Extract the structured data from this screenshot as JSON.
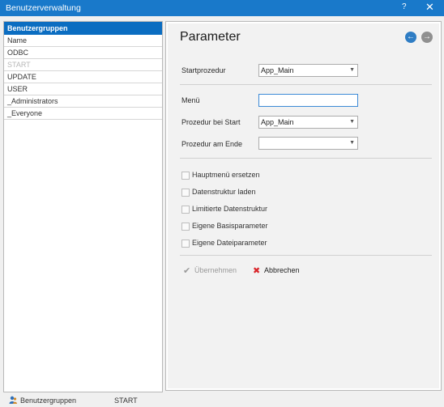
{
  "window": {
    "title": "Benutzerverwaltung",
    "help": "?",
    "close": "✕"
  },
  "left": {
    "header": "Benutzergruppen",
    "rows": [
      "Name",
      "ODBC",
      "START",
      "UPDATE",
      "USER",
      "_Administrators",
      "_Everyone"
    ]
  },
  "panel": {
    "title": "Parameter",
    "back": "←",
    "forward": "→",
    "startprozedur": {
      "label": "Startprozedur",
      "value": "App_Main"
    },
    "menu": {
      "label": "Menü",
      "value": ""
    },
    "prozedur_start": {
      "label": "Prozedur bei Start",
      "value": "App_Main"
    },
    "prozedur_ende": {
      "label": "Prozedur am Ende",
      "value": ""
    },
    "checkboxes": [
      "Hauptmenü ersetzen",
      "Datenstruktur laden",
      "Limitierte Datenstruktur",
      "Eigene Basisparameter",
      "Eigene Dateiparameter"
    ],
    "apply": "Übernehmen",
    "cancel": "Abbrechen",
    "dropdown_arrow": "▼"
  },
  "status": {
    "section": "Benutzergruppen",
    "value": "START"
  },
  "colors": {
    "titlebar": "#1979ca",
    "selection": "#0b6dc1",
    "cancel": "#d9252a"
  }
}
